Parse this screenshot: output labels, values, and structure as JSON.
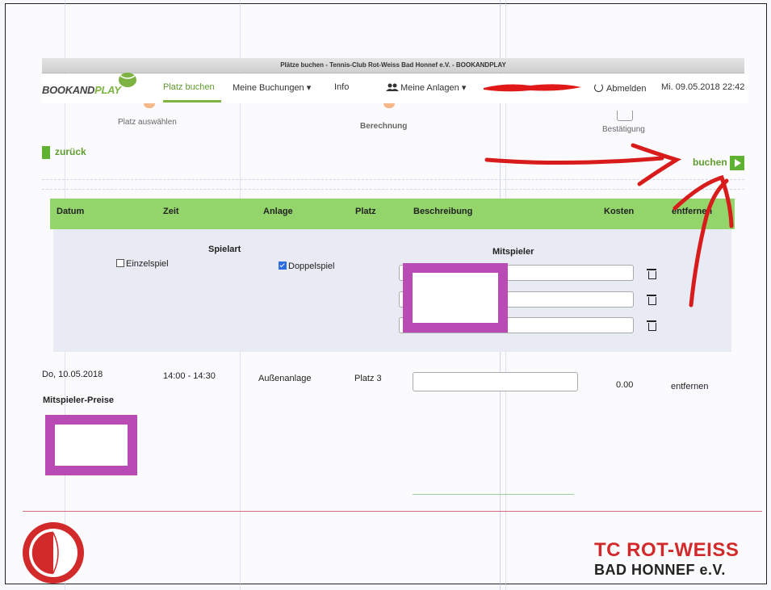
{
  "window": {
    "title": "Plätze buchen - Tennis-Club Rot-Weiss Bad Honnef e.V. - BOOKANDPLAY"
  },
  "nav": {
    "logo_part1": "BOOKAND",
    "logo_part2": "PLAY",
    "platz_buchen": "Platz buchen",
    "meine_buchungen": "Meine Buchungen ▾",
    "info": "Info",
    "meine_anlagen": "Meine Anlagen ▾",
    "abmelden": "Abmelden",
    "datetime": "Mi. 09.05.2018 22:42"
  },
  "steps": {
    "step1": "Platz auswählen",
    "step2": "Berechnung",
    "step3": "Bestätigung"
  },
  "actions": {
    "back": "zurück",
    "book": "buchen"
  },
  "table": {
    "headers": [
      "Datum",
      "Zeit",
      "Anlage",
      "Platz",
      "Beschreibung",
      "Kosten",
      "entfernen"
    ]
  },
  "game_type": {
    "heading": "Spielart",
    "single": "Einzelspiel",
    "single_checked": false,
    "double": "Doppelspiel",
    "double_checked": true,
    "players_heading": "Mitspieler"
  },
  "booking": {
    "date": "Do, 10.05.2018",
    "time": "14:00 - 14:30",
    "facility": "Außenanlage",
    "court": "Platz 3",
    "description": "",
    "cost": "0.00",
    "remove": "entfernen"
  },
  "prices_heading": "Mitspieler-Preise",
  "footer": {
    "title": "TC ROT-WEISS",
    "subtitle": "BAD HONNEF e.V.",
    "seal_text": "TENNISCLUB ROT-WEISS BAD HONNEF e.V."
  },
  "colors": {
    "green_header": "#93d46b",
    "green_accent": "#5fb231",
    "red": "#d22a2a",
    "redaction": "#b94bb5"
  }
}
